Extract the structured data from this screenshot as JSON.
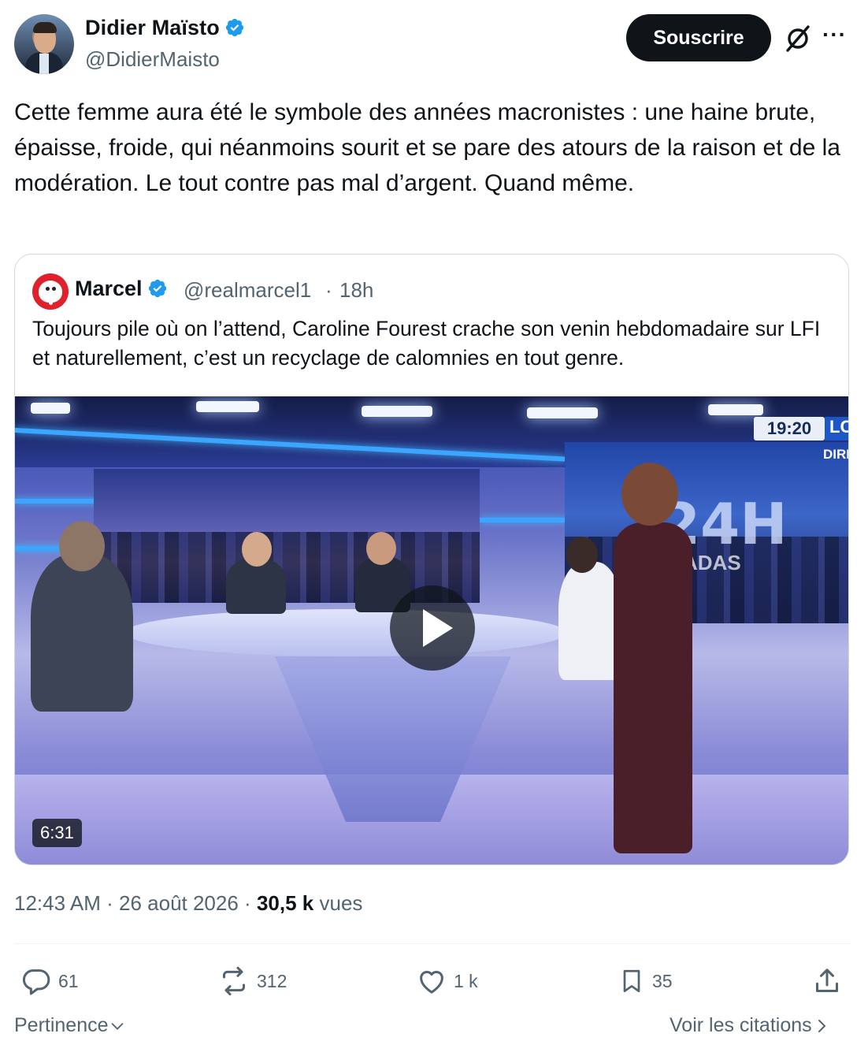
{
  "author": {
    "display_name": "Didier Maïsto",
    "handle": "@DidierMaisto",
    "verified_icon": "verified-badge-icon",
    "avatar": "profile-photo"
  },
  "header_actions": {
    "subscribe_label": "Souscrire",
    "grok_icon": "grok-slash-icon",
    "more_icon": "more-horizontal-icon",
    "more_glyph": "···"
  },
  "tweet": {
    "text": "Cette femme aura été le symbole des années macronistes : une haine brute, épaisse, froide, qui néanmoins sourit et se pare des atours de la raison et de la modération. Le tout contre pas mal d’argent. Quand même."
  },
  "quoted_tweet": {
    "display_name": "Marcel",
    "handle": "@realmarcel1",
    "separator": "·",
    "time_ago": "18h",
    "text": "Toujours pile où on l’attend, Caroline Fourest crache son venin hebdomadaire sur LFI et naturellement, c’est un recyclage de calomnies en tout genre.",
    "video": {
      "duration": "6:31",
      "clock": "19:20",
      "channel_abbrev": "LC",
      "direct_label": "DIRE",
      "set_logo": "24H",
      "set_sub": "ADAS",
      "play_icon": "play-icon"
    }
  },
  "meta": {
    "time": "12:43 AM",
    "separator": "·",
    "date": "26 août 2026",
    "views_count": "30,5 k",
    "views_label": "vues"
  },
  "actions": {
    "replies": "61",
    "retweets": "312",
    "likes": "1 k",
    "bookmarks": "35"
  },
  "footer": {
    "sort_label": "Pertinence",
    "quotes_link": "Voir les citations"
  },
  "colors": {
    "text_primary": "#0f1419",
    "text_secondary": "#536471",
    "verified_blue": "#1d9bf0",
    "border": "#cfd9de"
  }
}
